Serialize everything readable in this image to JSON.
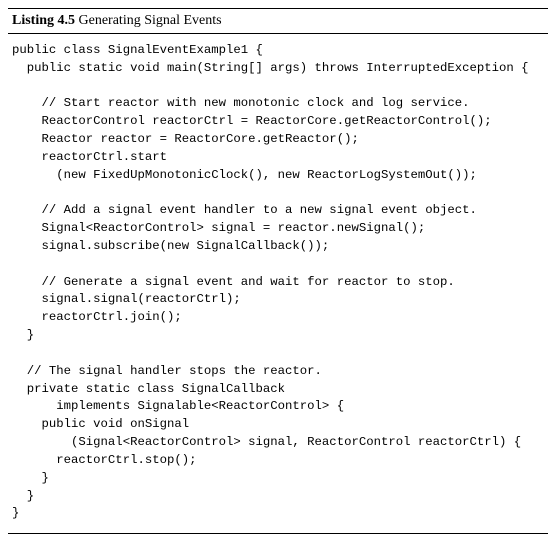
{
  "listing": {
    "label": "Listing 4.5",
    "caption": "Generating Signal Events",
    "code_lines": [
      "public class SignalEventExample1 {",
      "  public static void main(String[] args) throws InterruptedException {",
      "",
      "    // Start reactor with new monotonic clock and log service.",
      "    ReactorControl reactorCtrl = ReactorCore.getReactorControl();",
      "    Reactor reactor = ReactorCore.getReactor();",
      "    reactorCtrl.start",
      "      (new FixedUpMonotonicClock(), new ReactorLogSystemOut());",
      "",
      "    // Add a signal event handler to a new signal event object.",
      "    Signal<ReactorControl> signal = reactor.newSignal();",
      "    signal.subscribe(new SignalCallback());",
      "",
      "    // Generate a signal event and wait for reactor to stop.",
      "    signal.signal(reactorCtrl);",
      "    reactorCtrl.join();",
      "  }",
      "",
      "  // The signal handler stops the reactor.",
      "  private static class SignalCallback",
      "      implements Signalable<ReactorControl> {",
      "    public void onSignal",
      "        (Signal<ReactorControl> signal, ReactorControl reactorCtrl) {",
      "      reactorCtrl.stop();",
      "    }",
      "  }",
      "}"
    ]
  }
}
